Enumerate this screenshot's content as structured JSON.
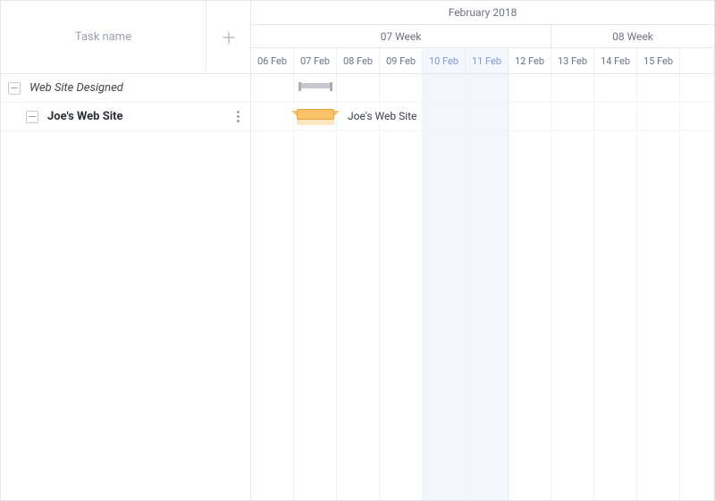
{
  "header": {
    "task_name_label": "Task name",
    "month_label": "February 2018",
    "weeks": [
      {
        "label": "07 Week",
        "span": 7
      },
      {
        "label": "08 Week",
        "span": 4
      }
    ],
    "days": [
      {
        "label": "06 Feb",
        "weekend": false
      },
      {
        "label": "07 Feb",
        "weekend": false
      },
      {
        "label": "08 Feb",
        "weekend": false
      },
      {
        "label": "09 Feb",
        "weekend": false
      },
      {
        "label": "10 Feb",
        "weekend": true
      },
      {
        "label": "11 Feb",
        "weekend": true
      },
      {
        "label": "12 Feb",
        "weekend": false
      },
      {
        "label": "13 Feb",
        "weekend": false
      },
      {
        "label": "14 Feb",
        "weekend": false
      },
      {
        "label": "15 Feb",
        "weekend": false
      },
      {
        "label": "",
        "weekend": false
      }
    ]
  },
  "tasks": [
    {
      "name": "Web Site Designed",
      "style": "summary",
      "indent": 0,
      "bar_label": "",
      "start_col": 1,
      "span_cols": 1
    },
    {
      "name": "Joe's Web Site",
      "style": "task",
      "indent": 1,
      "bar_label": "Joe's Web Site",
      "start_col": 1,
      "span_cols": 1
    }
  ],
  "colors": {
    "weekend_bg": "#f3f7fd",
    "task_bar": "#f9c26b",
    "task_bar_border": "#e8a23e",
    "summary_bar": "#c5c9cf"
  }
}
